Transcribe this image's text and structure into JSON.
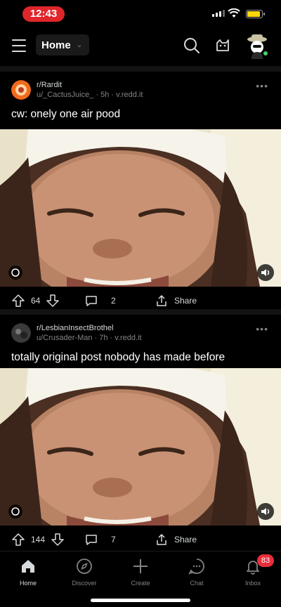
{
  "status_bar": {
    "time": "12:43"
  },
  "header": {
    "feed_selector": "Home",
    "icons": [
      "menu-icon",
      "search-icon",
      "coin-icon",
      "avatar"
    ]
  },
  "posts": [
    {
      "subreddit": "r/Rardit",
      "byline": "u/_CactusJuice_ · 5h · v.redd.it",
      "title": "cw: onely one air pood",
      "upvotes": "64",
      "comments": "2",
      "share_label": "Share",
      "icon_color": "#f26a1b"
    },
    {
      "subreddit": "r/LesbianInsectBrothel",
      "byline": "u/Crusader-Man · 7h · v.redd.it",
      "title": "totally original post nobody has made before",
      "upvotes": "144",
      "comments": "7",
      "share_label": "Share",
      "icon_color": "#3a3a3a"
    }
  ],
  "bottom_nav": {
    "items": [
      {
        "label": "Home",
        "icon": "home-icon",
        "active": true
      },
      {
        "label": "Discover",
        "icon": "compass-icon",
        "active": false
      },
      {
        "label": "Create",
        "icon": "plus-icon",
        "active": false
      },
      {
        "label": "Chat",
        "icon": "chat-icon",
        "active": false
      },
      {
        "label": "Inbox",
        "icon": "bell-icon",
        "active": false
      }
    ],
    "inbox_badge": "83"
  },
  "colors": {
    "background": "#000000",
    "time_pill": "#e0262b",
    "badge": "#ea2d3b",
    "online": "#46d160"
  }
}
